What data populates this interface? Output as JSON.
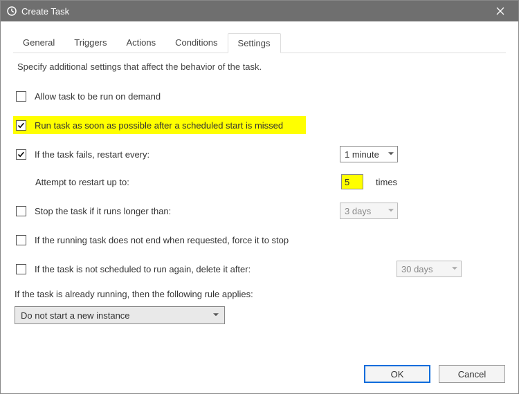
{
  "titlebar": {
    "title": "Create Task"
  },
  "tabs": {
    "general": "General",
    "triggers": "Triggers",
    "actions": "Actions",
    "conditions": "Conditions",
    "settings": "Settings"
  },
  "intro": "Specify additional settings that affect the behavior of the task.",
  "settings": {
    "allow_on_demand": "Allow task to be run on demand",
    "run_after_missed": "Run task as soon as possible after a scheduled start is missed",
    "if_fails_restart": "If the task fails, restart every:",
    "restart_interval": "1 minute",
    "attempt_label": "Attempt to restart up to:",
    "attempt_count": "5",
    "attempt_times": "times",
    "stop_longer": "Stop the task if it runs longer than:",
    "stop_longer_val": "3 days",
    "force_stop": "If the running task does not end when requested, force it to stop",
    "delete_after": "If the task is not scheduled to run again, delete it after:",
    "delete_after_val": "30 days",
    "rule_label": "If the task is already running, then the following rule applies:",
    "rule_value": "Do not start a new instance"
  },
  "buttons": {
    "ok": "OK",
    "cancel": "Cancel"
  }
}
